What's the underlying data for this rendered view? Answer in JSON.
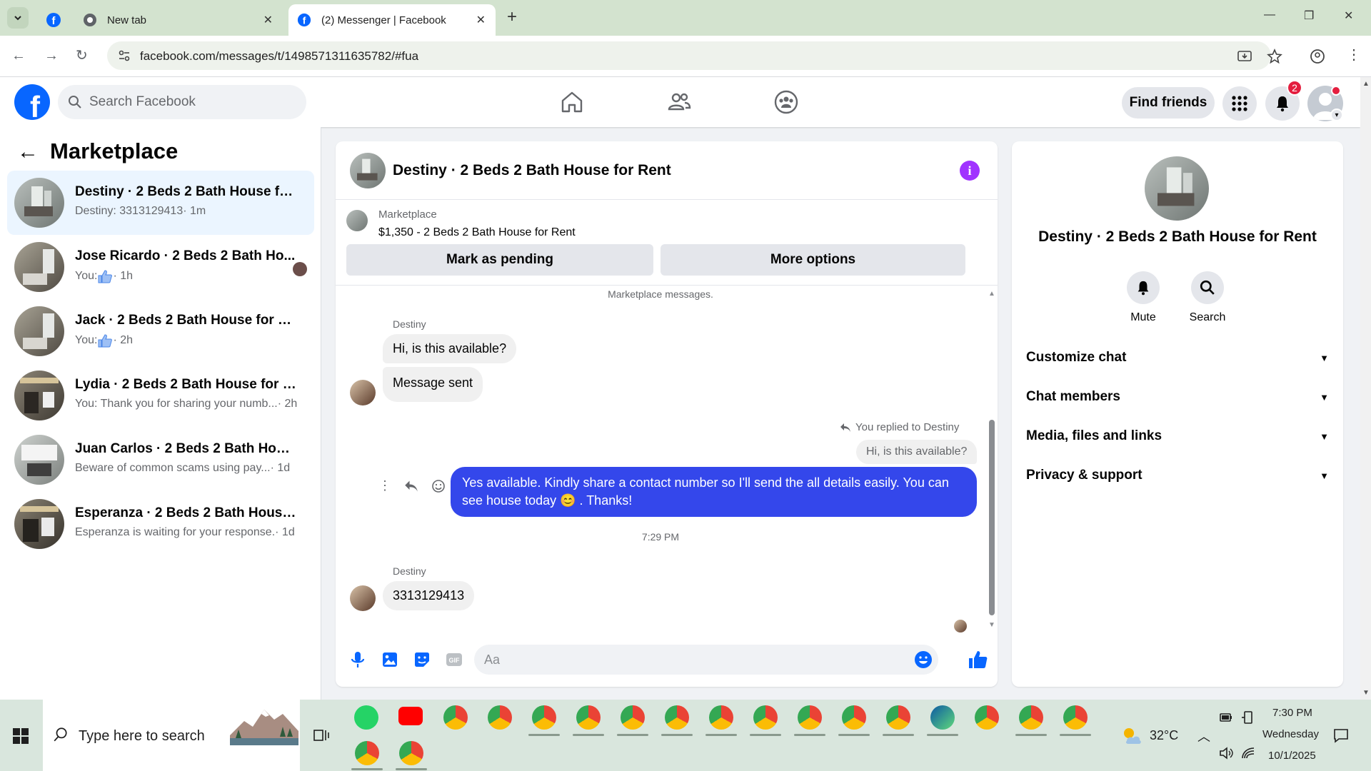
{
  "browser": {
    "tabs": [
      {
        "title": ""
      },
      {
        "title": "New tab"
      },
      {
        "title": "(2) Messenger | Facebook"
      }
    ],
    "url": "facebook.com/messages/t/1498571311635782/#fua"
  },
  "fb": {
    "search_placeholder": "Search Facebook",
    "find_friends": "Find friends",
    "notif_count": "2"
  },
  "left": {
    "title": "Marketplace",
    "conversations": [
      {
        "name": "Destiny · 2 Beds 2 Bath House for ...",
        "preview": "Destiny: 3313129413",
        "time": " · 1m",
        "thumb_color": "#9aa3a0"
      },
      {
        "name": "Jose Ricardo · 2 Beds 2 Bath Ho...",
        "preview": "You: ",
        "time": " · 1h",
        "thumb_color": "#8f8b80"
      },
      {
        "name": "Jack · 2 Beds 2 Bath House for Rent",
        "preview": "You: ",
        "time": " · 2h",
        "thumb_color": "#8f8b80"
      },
      {
        "name": "Lydia · 2 Beds 2 Bath House for Rent",
        "preview": "You: Thank you for sharing your numb...",
        "time": " · 2h",
        "thumb_color": "#7d776c"
      },
      {
        "name": "Juan Carlos · 2 Beds 2 Bath House ...",
        "preview": "Beware of common scams using pay...",
        "time": " · 1d",
        "thumb_color": "#a8aca8"
      },
      {
        "name": "Esperanza · 2 Beds 2 Bath House f...",
        "preview": "Esperanza is waiting for your response.",
        "time": " · 1d",
        "thumb_color": "#6f6a60"
      }
    ]
  },
  "chat": {
    "title": "Destiny · 2 Beds 2 Bath House for Rent",
    "listing_source": "Marketplace",
    "listing_price": "$1,350 - 2 Beds 2 Bath House for Rent",
    "mark_pending": "Mark as pending",
    "more_options": "More options",
    "system_note": "Marketplace messages.",
    "sender1": "Destiny",
    "msg1": "Hi, is this available?",
    "msg2": "Message sent",
    "reply_note": "You replied to Destiny",
    "quoted": "Hi, is this available?",
    "my_msg": "Yes available. Kindly share a contact number so I'll send the all details easily. You can see house today 😊 . Thanks!",
    "time_sep": "7:29 PM",
    "sender2": "Destiny",
    "msg3": "3313129413",
    "composer_placeholder": "Aa"
  },
  "info": {
    "name": "Destiny · 2 Beds 2 Bath House for Rent",
    "mute": "Mute",
    "search": "Search",
    "sections": [
      "Customize chat",
      "Chat members",
      "Media, files and links",
      "Privacy & support"
    ]
  },
  "taskbar": {
    "search_placeholder": "Type here to search",
    "weather": "32°C",
    "time": "7:30 PM",
    "day": "Wednesday",
    "date": "10/1/2025"
  },
  "colors": {
    "fb_blue": "#0866ff",
    "my_bubble": "#3447eb",
    "badge_red": "#e41e3f",
    "info_purple": "#a033ff"
  }
}
